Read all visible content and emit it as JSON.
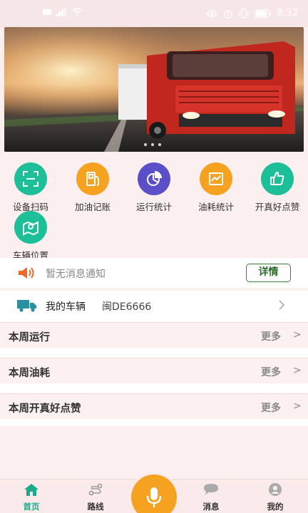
{
  "status_bar": {
    "time": "8:32"
  },
  "banner": {
    "dot_count": 3
  },
  "quick_actions": [
    {
      "label": "设备扫码",
      "icon": "scan-icon",
      "color": "#1dbf98"
    },
    {
      "label": "加油记账",
      "icon": "fuel-pump-icon",
      "color": "#f5a221"
    },
    {
      "label": "运行统计",
      "icon": "pie-chart-icon",
      "color": "#5b4fc9"
    },
    {
      "label": "油耗统计",
      "icon": "line-chart-icon",
      "color": "#f5a221"
    },
    {
      "label": "开真好点赞",
      "icon": "thumbs-up-icon",
      "color": "#1dbf98"
    },
    {
      "label": "车辆位置",
      "icon": "map-location-icon",
      "color": "#1dbf98"
    }
  ],
  "notice": {
    "text": "暂无消息通知",
    "detail_label": "详情"
  },
  "vehicle": {
    "label": "我的车辆",
    "plate": "闽DE6666"
  },
  "sections": [
    {
      "title": "本周运行",
      "more": "更多",
      "arrow": ">"
    },
    {
      "title": "本周油耗",
      "more": "更多",
      "arrow": ">"
    },
    {
      "title": "本周开真好点赞",
      "more": "更多",
      "arrow": ">"
    }
  ],
  "tabs": [
    {
      "label": "首页",
      "icon": "home-icon",
      "active": true
    },
    {
      "label": "路线",
      "icon": "route-icon",
      "active": false
    },
    {
      "label": "消息",
      "icon": "message-icon",
      "active": false
    },
    {
      "label": "我的",
      "icon": "user-icon",
      "active": false
    }
  ],
  "colors": {
    "accent": "#1aaa8c",
    "orange": "#f5a221",
    "purple": "#5b4fc9",
    "detail_border": "#3e7f3b"
  }
}
